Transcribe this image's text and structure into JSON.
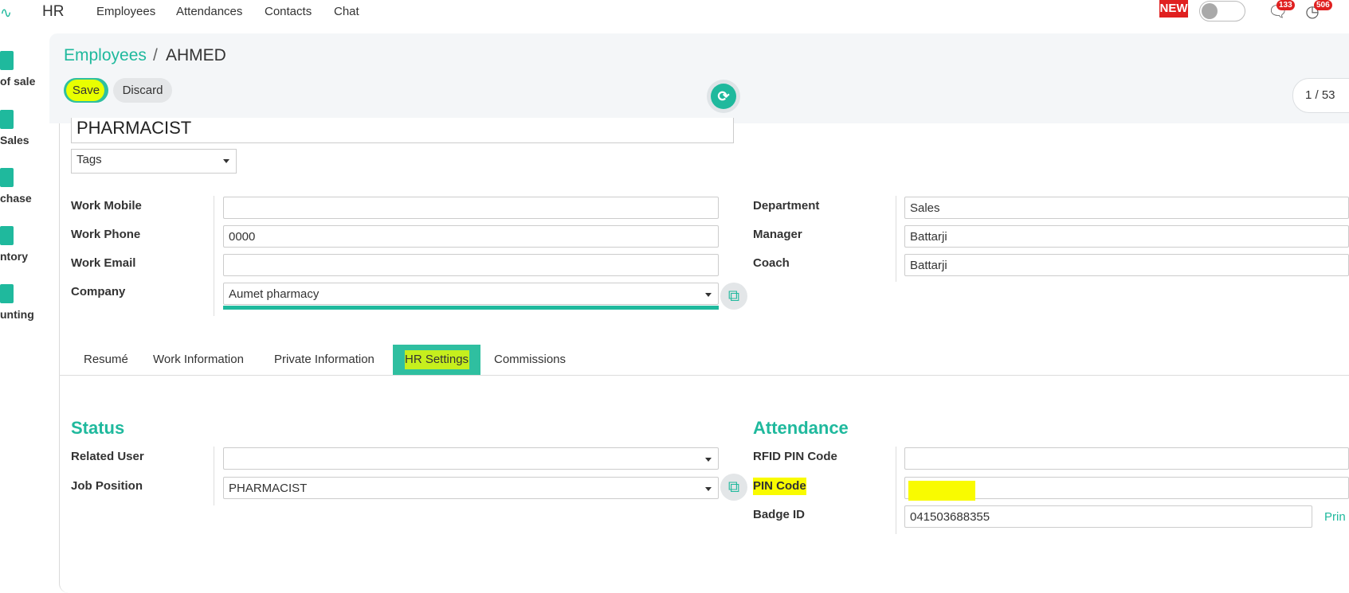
{
  "topnav": {
    "app_title": "HR",
    "menu": [
      "Employees",
      "Attendances",
      "Contacts",
      "Chat"
    ],
    "new_badge": "NEW",
    "messages_count": "133",
    "activities_count": "506"
  },
  "apps_sidebar": [
    "of sale",
    "Sales",
    "chase",
    "ntory",
    "unting"
  ],
  "breadcrumb": {
    "parent": "Employees",
    "separator": "/",
    "current": "AHMED"
  },
  "buttons": {
    "save": "Save",
    "discard": "Discard"
  },
  "pager": {
    "value": "1 / 53"
  },
  "employee": {
    "job_title": "PHARMACIST",
    "tags_placeholder": "Tags"
  },
  "contact": {
    "work_mobile_label": "Work Mobile",
    "work_mobile": "",
    "work_phone_label": "Work Phone",
    "work_phone": "0000",
    "work_email_label": "Work Email",
    "work_email": "",
    "company_label": "Company",
    "company": "Aumet pharmacy",
    "department_label": "Department",
    "department": "Sales",
    "manager_label": "Manager",
    "manager": "Battarji",
    "coach_label": "Coach",
    "coach": "Battarji"
  },
  "tabs": [
    "Resumé",
    "Work Information",
    "Private Information",
    "HR Settings",
    "Commissions"
  ],
  "active_tab": "HR Settings",
  "status": {
    "title": "Status",
    "related_user_label": "Related User",
    "related_user": "",
    "job_position_label": "Job Position",
    "job_position": "PHARMACIST"
  },
  "attendance": {
    "title": "Attendance",
    "rfid_label": "RFID PIN Code",
    "rfid": "",
    "pin_label": "PIN Code",
    "pin": "",
    "badge_label": "Badge ID",
    "badge": "041503688355",
    "print_link": "Prin"
  },
  "colors": {
    "accent": "#1fb99d",
    "highlight": "#f9fb00",
    "danger": "#e02020"
  }
}
